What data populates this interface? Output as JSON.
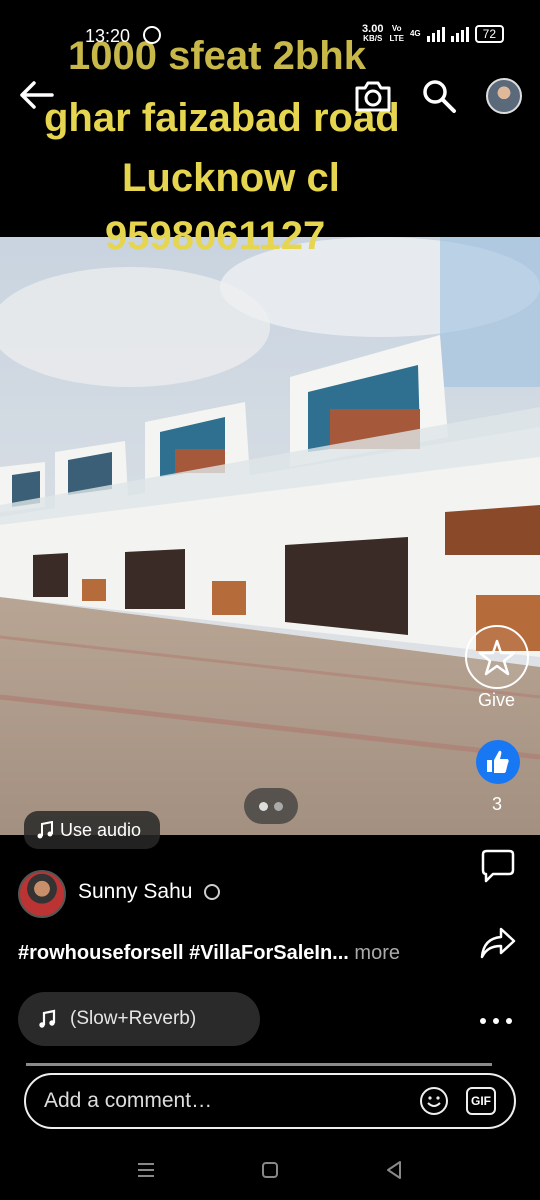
{
  "status_bar": {
    "time": "13:20",
    "net_speed": "3.00",
    "net_unit": "KB/S",
    "volte": "Vo",
    "lte": "LTE",
    "network": "4G",
    "battery": "72"
  },
  "overlay_title": {
    "line1": "1000 sfeat 2bhk",
    "line2": "ghar faizabad road",
    "line3": "Lucknow cl",
    "line4": "9598061127"
  },
  "toolbar_icons": [
    "back-arrow-icon",
    "camera-icon",
    "search-icon",
    "profile-avatar"
  ],
  "media": {
    "use_audio_label": "Use audio",
    "pages_total": 2,
    "current_page": 1
  },
  "actions": {
    "give_label": "Give",
    "like_count": "3"
  },
  "post": {
    "author": "Sunny Sahu",
    "caption": "#rowhouseforsell #VillaForSaleIn...",
    "more_label": "more",
    "audio_track": "(Slow+Reverb)"
  },
  "comment": {
    "placeholder": "Add a comment…",
    "gif_label": "GIF"
  },
  "colors": {
    "title_yellow": "#e6d54f",
    "like_blue": "#1877f2",
    "background": "#000000"
  }
}
